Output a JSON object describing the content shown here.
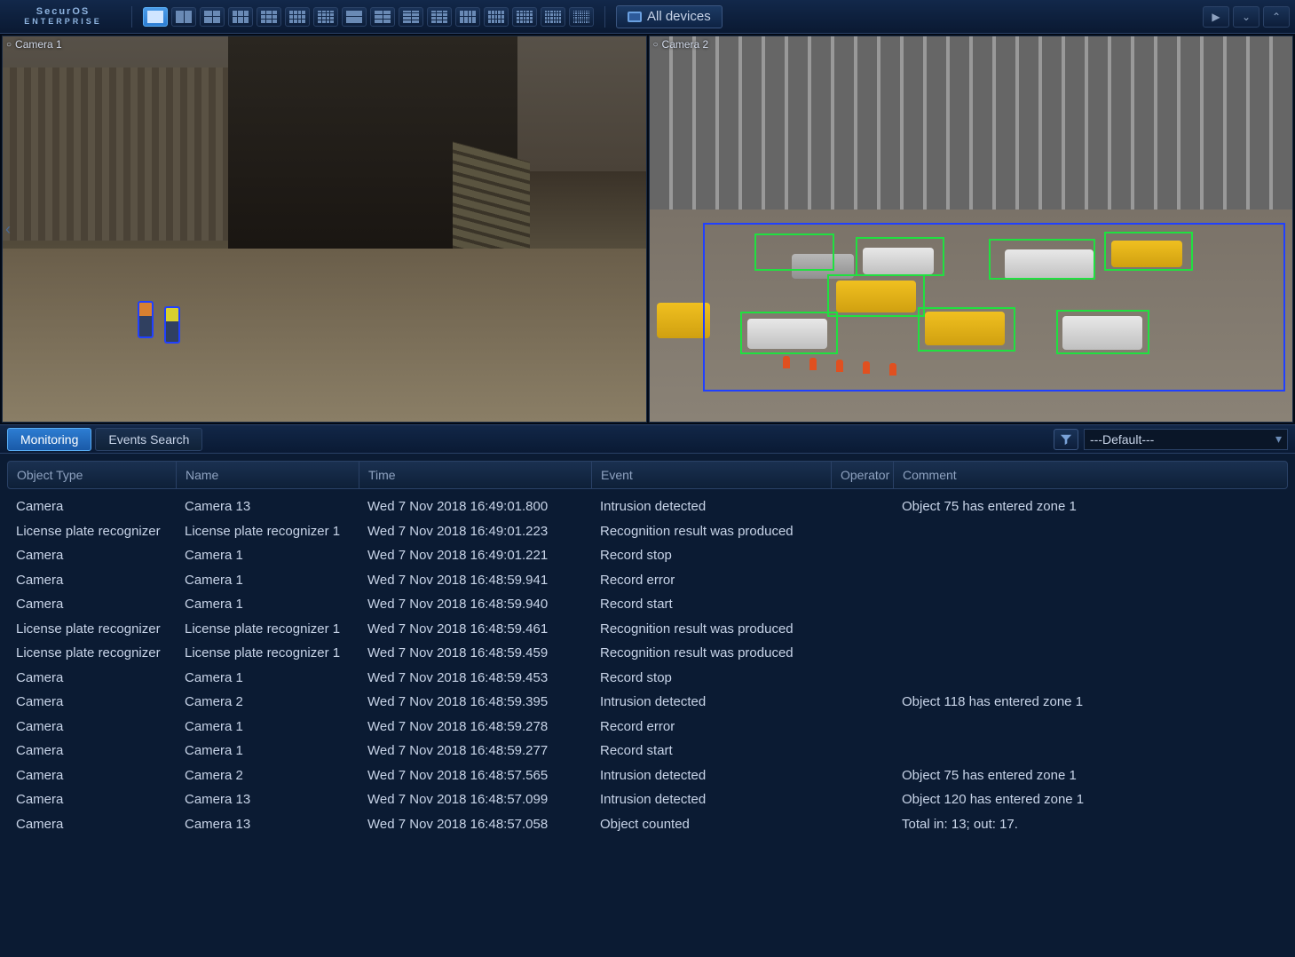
{
  "app": {
    "name": "SecurOS",
    "edition": "ENTERPRISE"
  },
  "toolbar": {
    "all_devices_label": "All devices",
    "layouts_count": 16
  },
  "cameras": [
    {
      "label": "Camera 1"
    },
    {
      "label": "Camera 2"
    }
  ],
  "tabs": {
    "monitoring": "Monitoring",
    "events_search": "Events Search",
    "active": "monitoring"
  },
  "filter": {
    "default_label": "---Default---"
  },
  "columns": {
    "object_type": "Object Type",
    "name": "Name",
    "time": "Time",
    "event": "Event",
    "operator": "Operator",
    "comment": "Comment"
  },
  "events": [
    {
      "type": "Camera",
      "name": "Camera 13",
      "time": "Wed 7 Nov 2018  16:49:01.800",
      "event": "Intrusion detected",
      "op": "",
      "comment": "Object 75 has entered zone 1"
    },
    {
      "type": "License plate recognizer",
      "name": "License plate recognizer 1",
      "time": "Wed 7 Nov 2018  16:49:01.223",
      "event": "Recognition result was produced",
      "op": "",
      "comment": ""
    },
    {
      "type": "Camera",
      "name": "Camera 1",
      "time": "Wed 7 Nov 2018  16:49:01.221",
      "event": "Record stop",
      "op": "",
      "comment": ""
    },
    {
      "type": "Camera",
      "name": "Camera 1",
      "time": "Wed 7 Nov 2018  16:48:59.941",
      "event": "Record error",
      "op": "",
      "comment": ""
    },
    {
      "type": "Camera",
      "name": "Camera 1",
      "time": "Wed 7 Nov 2018  16:48:59.940",
      "event": "Record start",
      "op": "",
      "comment": ""
    },
    {
      "type": "License plate recognizer",
      "name": "License plate recognizer 1",
      "time": "Wed 7 Nov 2018  16:48:59.461",
      "event": "Recognition result was produced",
      "op": "",
      "comment": ""
    },
    {
      "type": "License plate recognizer",
      "name": "License plate recognizer 1",
      "time": "Wed 7 Nov 2018  16:48:59.459",
      "event": "Recognition result was produced",
      "op": "",
      "comment": ""
    },
    {
      "type": "Camera",
      "name": "Camera 1",
      "time": "Wed 7 Nov 2018  16:48:59.453",
      "event": "Record stop",
      "op": "",
      "comment": ""
    },
    {
      "type": "Camera",
      "name": "Camera 2",
      "time": "Wed 7 Nov 2018  16:48:59.395",
      "event": "Intrusion detected",
      "op": "",
      "comment": "Object 118 has entered zone 1"
    },
    {
      "type": "Camera",
      "name": "Camera 1",
      "time": "Wed 7 Nov 2018  16:48:59.278",
      "event": "Record error",
      "op": "",
      "comment": ""
    },
    {
      "type": "Camera",
      "name": "Camera 1",
      "time": "Wed 7 Nov 2018  16:48:59.277",
      "event": "Record start",
      "op": "",
      "comment": ""
    },
    {
      "type": "Camera",
      "name": "Camera 2",
      "time": "Wed 7 Nov 2018  16:48:57.565",
      "event": "Intrusion detected",
      "op": "",
      "comment": "Object 75 has entered zone 1"
    },
    {
      "type": "Camera",
      "name": "Camera 13",
      "time": "Wed 7 Nov 2018  16:48:57.099",
      "event": "Intrusion detected",
      "op": "",
      "comment": "Object 120 has entered zone 1"
    },
    {
      "type": "Camera",
      "name": "Camera 13",
      "time": "Wed 7 Nov 2018  16:48:57.058",
      "event": "Object counted",
      "op": "",
      "comment": "Total in: 13; out: 17."
    }
  ]
}
